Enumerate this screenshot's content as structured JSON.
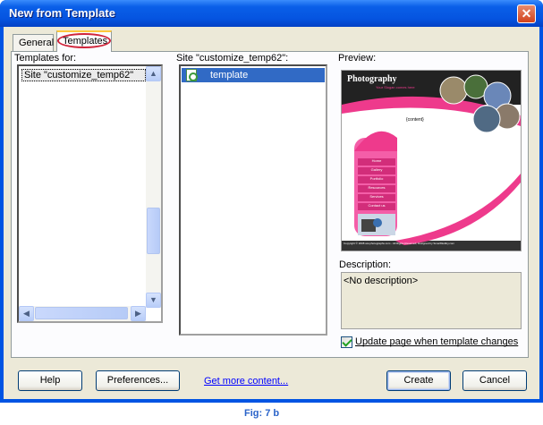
{
  "window": {
    "title": "New from Template",
    "close_glyph": "✕"
  },
  "tabs": [
    {
      "label": "General"
    },
    {
      "label": "Templates"
    }
  ],
  "templates_for": {
    "label": "Templates for:",
    "items": [
      "Site \"customize_temp62\""
    ]
  },
  "site_list": {
    "label": "Site \"customize_temp62\":",
    "items": [
      "template"
    ]
  },
  "preview": {
    "label": "Preview:",
    "site_title": "Photography",
    "tagline": "Your Slogan comes here",
    "content_placeholder": "{content}",
    "menu": [
      "Home",
      "Gallery",
      "Portfolio",
      "Resources",
      "Services",
      "Contact us"
    ],
    "footer": "Copyright © 2008 ww.photographs.com - All Rights Reserved, Designed by SmartWebby.com"
  },
  "description": {
    "label": "Description:",
    "value": "<No description>"
  },
  "update_checkbox": {
    "label": "Update page when template changes",
    "checked": true
  },
  "buttons": {
    "help": "Help",
    "preferences": "Preferences...",
    "get_more": "Get more content...",
    "create": "Create",
    "cancel": "Cancel"
  },
  "caption": "Fig: 7 b",
  "colors": {
    "accent_pink": "#ee3a8c",
    "selection": "#316ac5",
    "title_bar": "#0054e3"
  }
}
